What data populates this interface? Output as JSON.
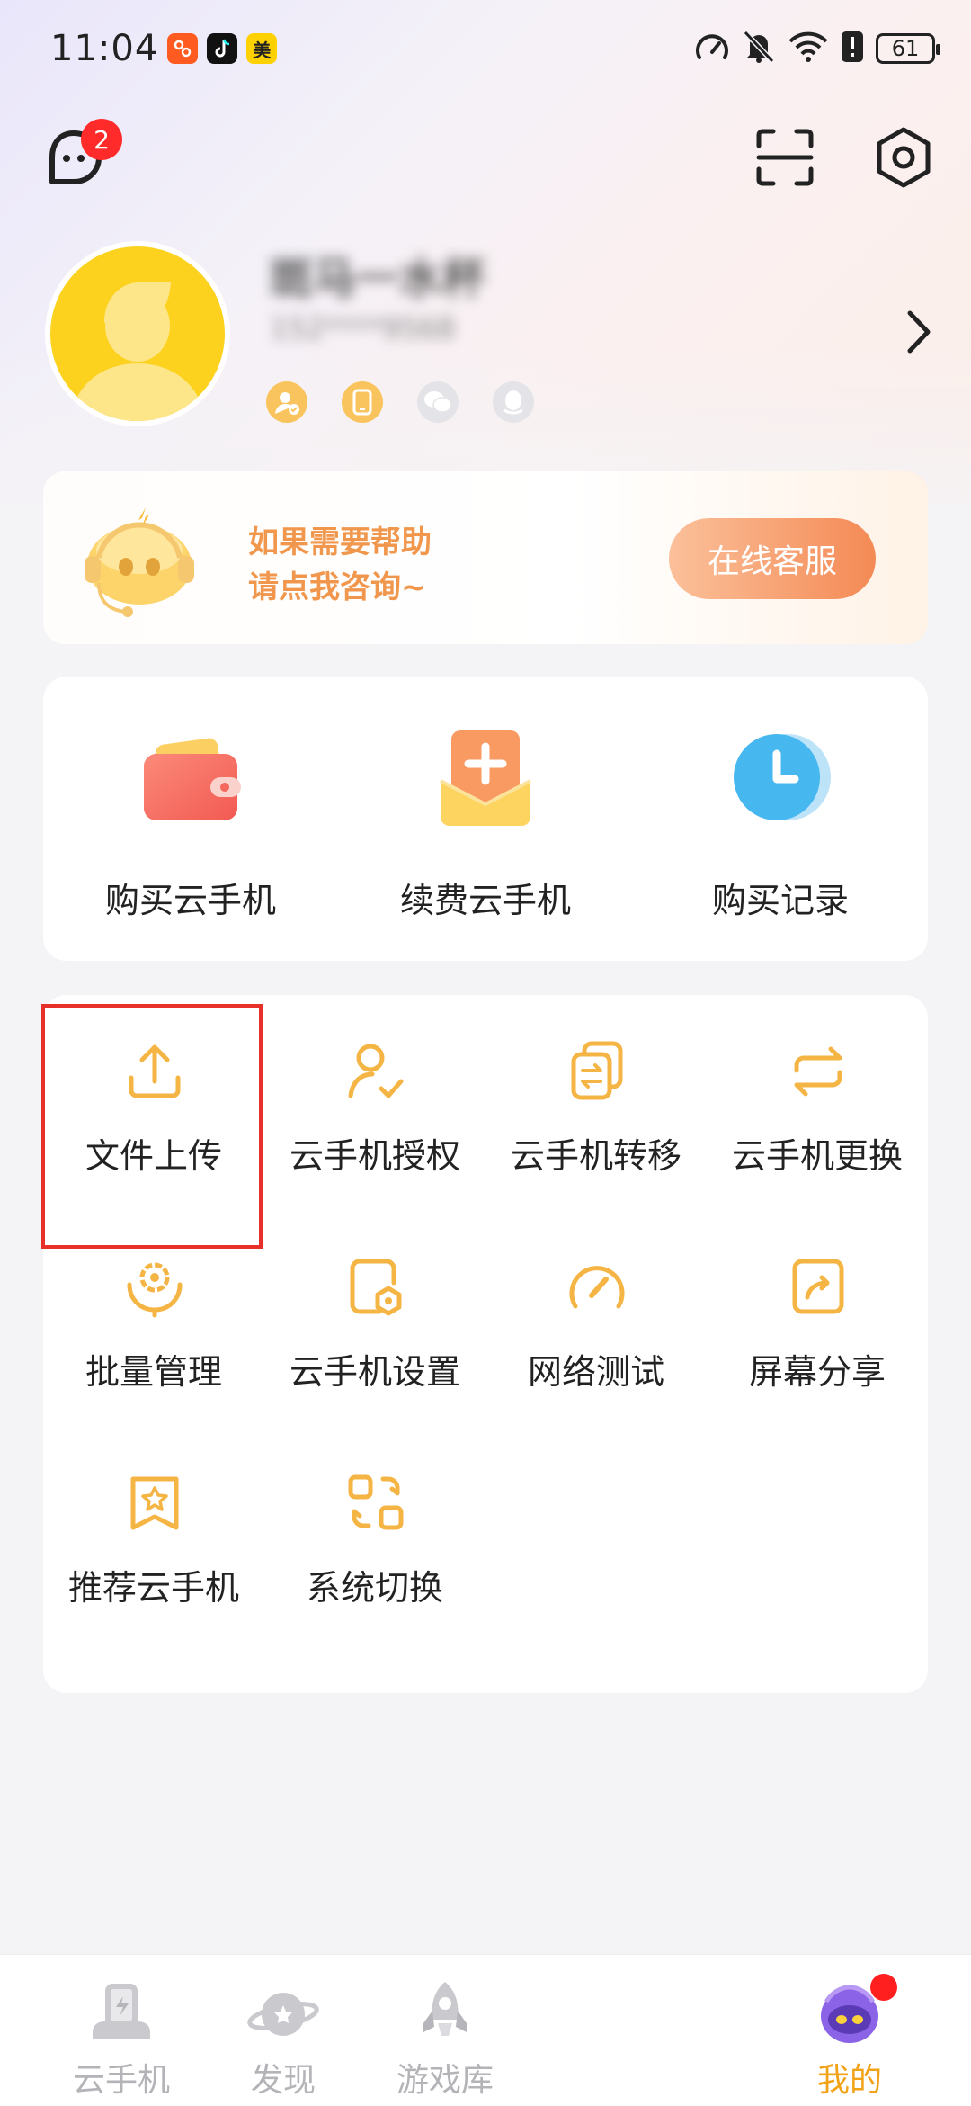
{
  "status_bar": {
    "time": "11:04",
    "battery": "61",
    "apps": [
      {
        "icon": "xiaohongshu-icon",
        "glyph": "",
        "color": "#ff5a1f"
      },
      {
        "icon": "tiktok-icon",
        "glyph": "",
        "color": "#111111"
      },
      {
        "icon": "meituan-icon",
        "glyph": "美",
        "color": "#ffd100"
      }
    ]
  },
  "header": {
    "message_badge": "2"
  },
  "profile": {
    "name": "斑马一水杯",
    "phone": "152****9568"
  },
  "help_banner": {
    "line1": "如果需要帮助",
    "line2": "请点我咨询~",
    "button": "在线客服"
  },
  "quick_actions": [
    {
      "label": "购买云手机",
      "icon": "wallet-icon"
    },
    {
      "label": "续费云手机",
      "icon": "renew-envelope-icon"
    },
    {
      "label": "购买记录",
      "icon": "clock-icon"
    }
  ],
  "tools": [
    {
      "label": "文件上传",
      "icon": "upload-icon"
    },
    {
      "label": "云手机授权",
      "icon": "user-check-icon"
    },
    {
      "label": "云手机转移",
      "icon": "transfer-icon"
    },
    {
      "label": "云手机更换",
      "icon": "swap-icon"
    },
    {
      "label": "批量管理",
      "icon": "batch-gear-icon"
    },
    {
      "label": "云手机设置",
      "icon": "phone-settings-icon"
    },
    {
      "label": "网络测试",
      "icon": "speedometer-icon"
    },
    {
      "label": "屏幕分享",
      "icon": "share-screen-icon"
    },
    {
      "label": "推荐云手机",
      "icon": "star-bookmark-icon"
    },
    {
      "label": "系统切换",
      "icon": "system-switch-icon"
    }
  ],
  "bottom_nav": [
    {
      "label": "云手机",
      "icon": "cloud-phone-icon",
      "active": false
    },
    {
      "label": "发现",
      "icon": "planet-icon",
      "active": false
    },
    {
      "label": "游戏库",
      "icon": "rocket-icon",
      "active": false
    },
    {
      "label": "我的",
      "icon": "robot-avatar-icon",
      "active": true
    }
  ],
  "colors": {
    "accent": "#f2a216",
    "icon_orange": "#f5b545",
    "highlight_border": "#e8302a",
    "badge_red": "#ff2a2a"
  }
}
